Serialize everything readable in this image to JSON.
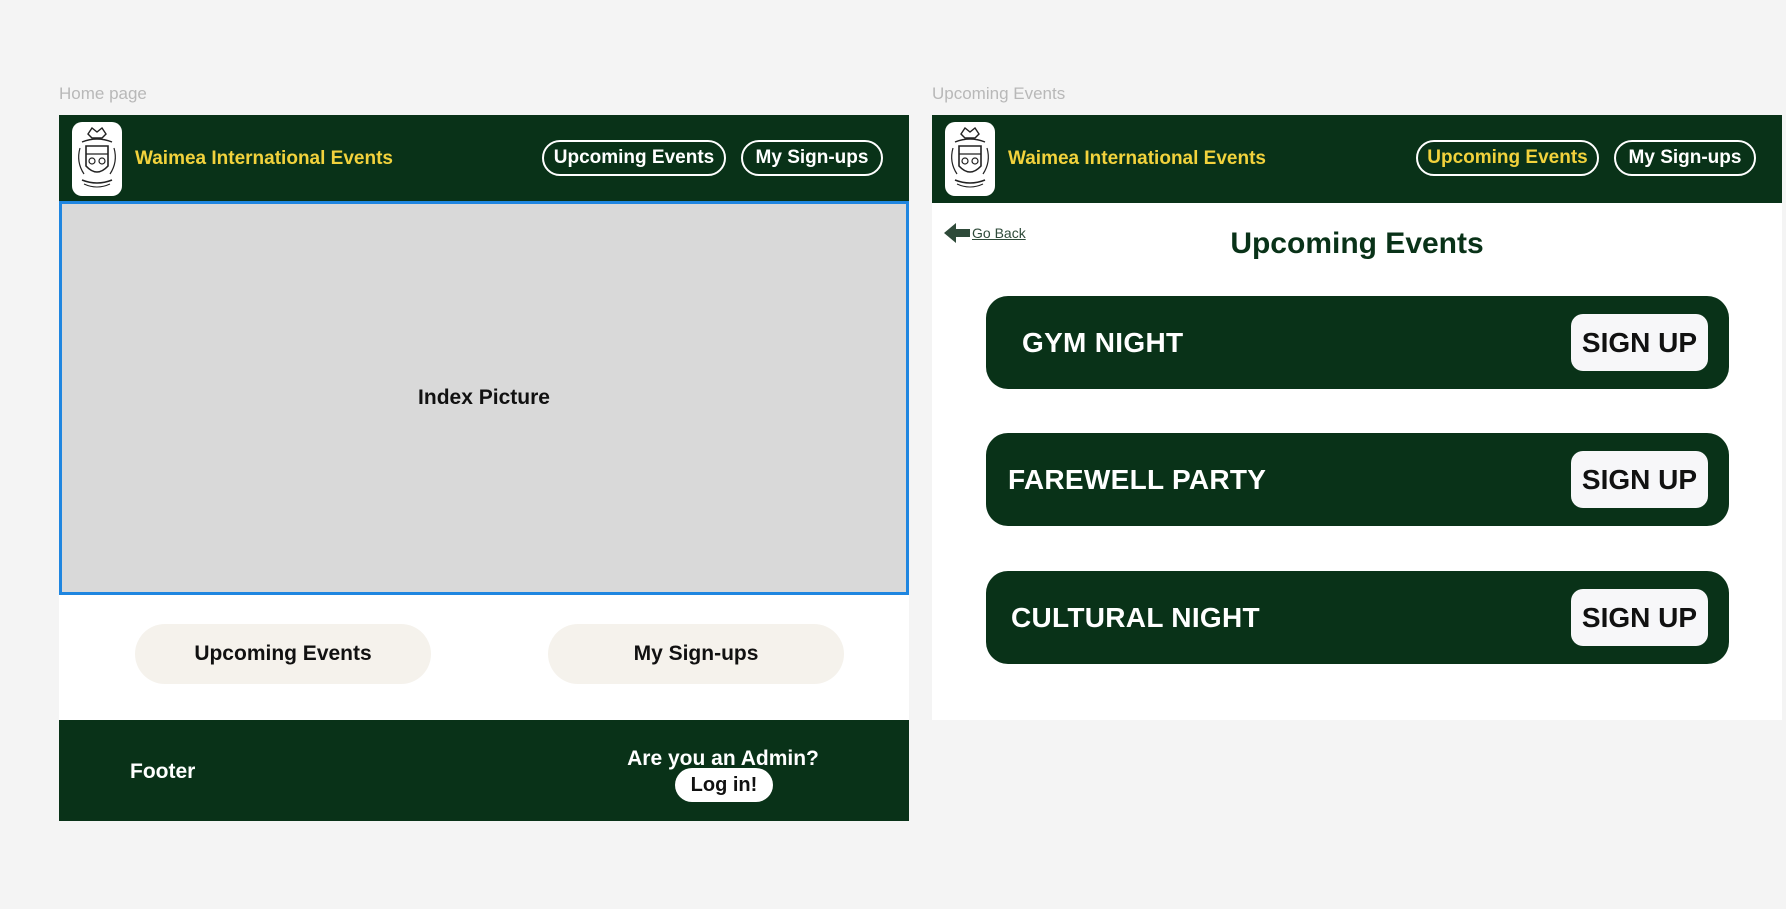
{
  "frames": {
    "home_label": "Home page",
    "events_label": "Upcoming Events"
  },
  "header": {
    "site_title": "Waimea International Events",
    "nav": {
      "upcoming_events": "Upcoming Events",
      "my_signups": "My Sign-ups"
    },
    "logo_icon": "school-crest-icon"
  },
  "home": {
    "hero_label": "Index Picture",
    "buttons": {
      "upcoming_events": "Upcoming Events",
      "my_signups": "My Sign-ups"
    },
    "footer": {
      "label": "Footer",
      "admin_prompt": "Are you an Admin?",
      "login_label": "Log in!"
    }
  },
  "events": {
    "go_back_label": "Go Back",
    "go_back_icon": "arrow-left-icon",
    "title": "Upcoming Events",
    "list": [
      {
        "name": "GYM NIGHT",
        "action": "SIGN UP"
      },
      {
        "name": "FAREWELL PARTY",
        "action": "SIGN UP"
      },
      {
        "name": "CULTURAL NIGHT",
        "action": "SIGN UP"
      }
    ]
  },
  "colors": {
    "brand_green": "#093218",
    "accent_yellow": "#f2d23c",
    "selection_blue": "#1f86e0",
    "pill_background": "#f5f2ec",
    "canvas": "#f4f4f4"
  }
}
